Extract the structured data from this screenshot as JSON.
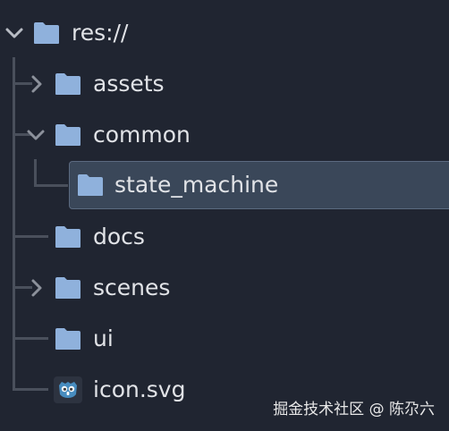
{
  "tree": {
    "root": {
      "label": "res://",
      "expanded": true
    },
    "items": [
      {
        "label": "assets",
        "type": "folder",
        "expandable": true,
        "expanded": false
      },
      {
        "label": "common",
        "type": "folder",
        "expandable": true,
        "expanded": true,
        "children": [
          {
            "label": "state_machine",
            "type": "folder",
            "selected": true
          }
        ]
      },
      {
        "label": "docs",
        "type": "folder",
        "expandable": false
      },
      {
        "label": "scenes",
        "type": "folder",
        "expandable": true,
        "expanded": false
      },
      {
        "label": "ui",
        "type": "folder",
        "expandable": false
      },
      {
        "label": "icon.svg",
        "type": "file",
        "icon": "godot-icon"
      }
    ]
  },
  "watermark": "掘金技术社区 @ 陈尕六",
  "colors": {
    "background": "#202531",
    "folder": "#8fb1dc",
    "text": "#e1e3e7",
    "guide_line": "#4a505c",
    "selection": "#3a4759",
    "godot_icon": "#478cbf"
  }
}
